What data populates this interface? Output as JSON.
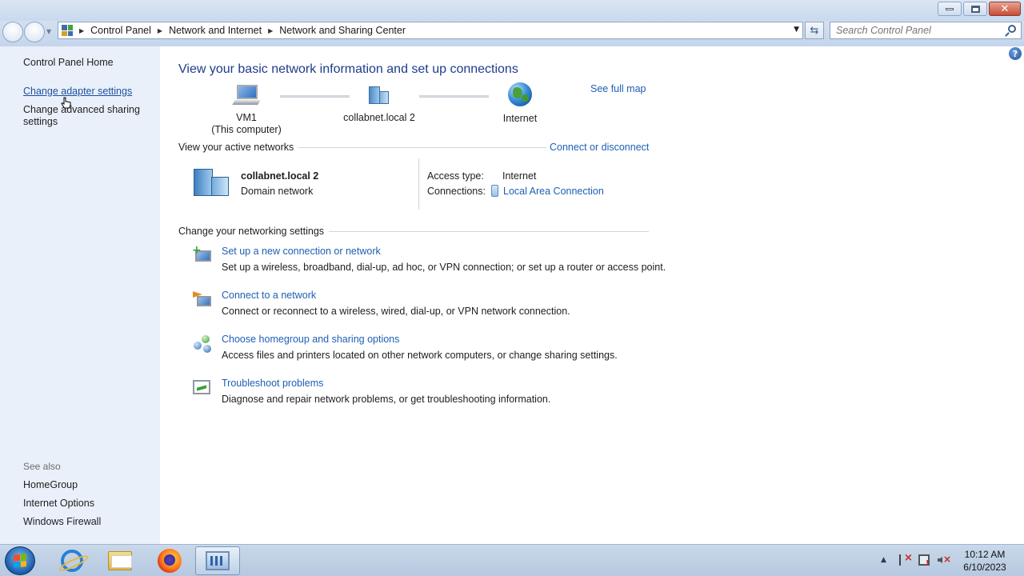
{
  "window": {
    "caption_buttons": {
      "minimize": "minimize-icon",
      "maximize": "maximize-icon",
      "close": "close-icon"
    }
  },
  "address_bar": {
    "breadcrumbs": [
      "Control Panel",
      "Network and Internet",
      "Network and Sharing Center"
    ],
    "search_placeholder": "Search Control Panel"
  },
  "sidebar": {
    "home": "Control Panel Home",
    "links": [
      "Change adapter settings",
      "Change advanced sharing settings"
    ],
    "see_also_label": "See also",
    "see_also": [
      "HomeGroup",
      "Internet Options",
      "Windows Firewall"
    ]
  },
  "main": {
    "title": "View your basic network information and set up connections",
    "see_full_map": "See full map",
    "map": {
      "computer": {
        "name": "VM1",
        "sub": "(This computer)"
      },
      "network": {
        "name": "collabnet.local  2"
      },
      "internet": {
        "name": "Internet"
      }
    },
    "active_networks": {
      "heading": "View your active networks",
      "connect_link": "Connect or disconnect",
      "network_name": "collabnet.local  2",
      "network_type": "Domain network",
      "access_type_label": "Access type:",
      "access_type_value": "Internet",
      "connections_label": "Connections:",
      "connections_value": "Local Area Connection"
    },
    "settings": {
      "heading": "Change your networking settings",
      "tasks": [
        {
          "link": "Set up a new connection or network",
          "desc": "Set up a wireless, broadband, dial-up, ad hoc, or VPN connection; or set up a router or access point."
        },
        {
          "link": "Connect to a network",
          "desc": "Connect or reconnect to a wireless, wired, dial-up, or VPN network connection."
        },
        {
          "link": "Choose homegroup and sharing options",
          "desc": "Access files and printers located on other network computers, or change sharing settings."
        },
        {
          "link": "Troubleshoot problems",
          "desc": "Diagnose and repair network problems, or get troubleshooting information."
        }
      ]
    }
  },
  "taskbar": {
    "time": "10:12 AM",
    "date": "6/10/2023"
  },
  "colors": {
    "link": "#1e5fb4",
    "title": "#1e3c8c",
    "sidebar_bg": "#e9f0fa"
  }
}
